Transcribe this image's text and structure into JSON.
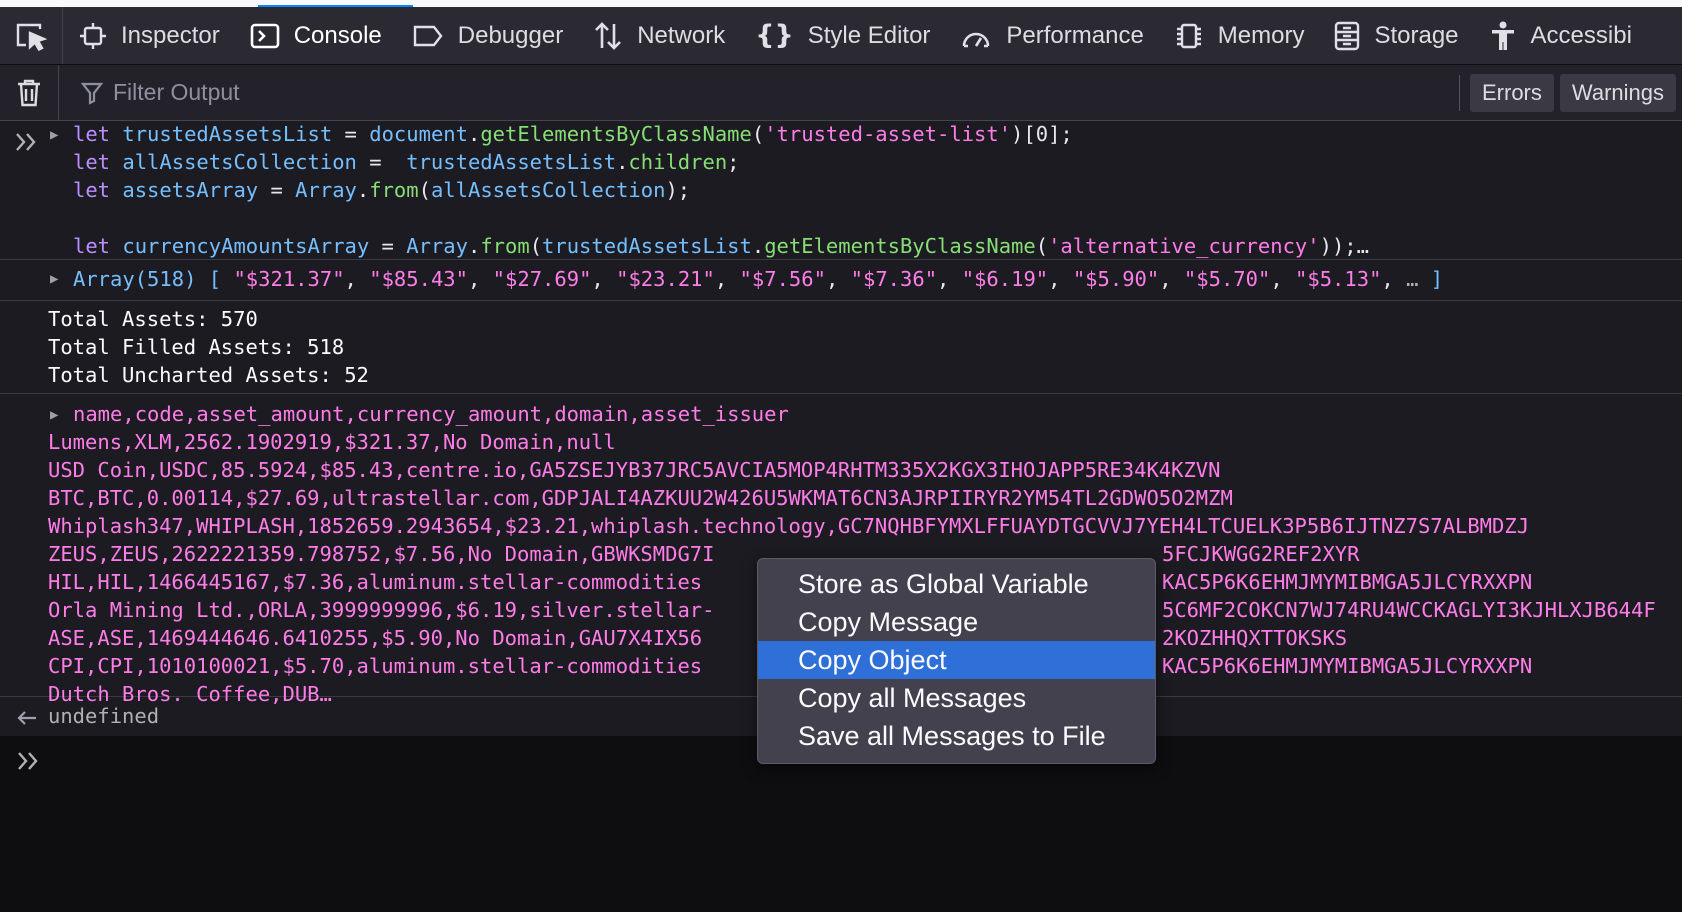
{
  "tabs": [
    {
      "label": "Inspector",
      "icon": "inspector-icon"
    },
    {
      "label": "Console",
      "icon": "console-icon",
      "selected": true
    },
    {
      "label": "Debugger",
      "icon": "debugger-icon"
    },
    {
      "label": "Network",
      "icon": "network-icon"
    },
    {
      "label": "Style Editor",
      "icon": "style-editor-icon"
    },
    {
      "label": "Performance",
      "icon": "performance-icon"
    },
    {
      "label": "Memory",
      "icon": "memory-icon"
    },
    {
      "label": "Storage",
      "icon": "storage-icon"
    },
    {
      "label": "Accessibi",
      "icon": "accessibility-icon"
    }
  ],
  "toolbar": {
    "filter_placeholder": "Filter Output",
    "errors_label": "Errors",
    "warnings_label": "Warnings"
  },
  "input_code": {
    "line1": {
      "kw": "let",
      "var": "trustedAssetsList",
      "op": " = ",
      "obj": "document",
      "fn": "getElementsByClassName",
      "str": "'trusted-asset-list'",
      "idx": ")[0];"
    },
    "line2": {
      "kw": "let",
      "var": "allAssetsCollection",
      "op": " =  ",
      "obj": "trustedAssetsList",
      "prop": "children",
      "end": ";"
    },
    "line3": {
      "kw": "let",
      "var": "assetsArray",
      "op": " = ",
      "obj": "Array",
      "fn": "from",
      "arg": "allAssetsCollection",
      "end": ");"
    },
    "line5": {
      "kw": "let",
      "var": "currencyAmountsArray",
      "op": " = ",
      "obj": "Array",
      "fn": "from",
      "arg_obj": "trustedAssetsList",
      "fn2": "getElementsByClassName",
      "str": "'alternative_currency'",
      "end": "));…"
    }
  },
  "array_output": {
    "label": "Array(518)",
    "items": [
      "\"$321.37\"",
      "\"$85.43\"",
      "\"$27.69\"",
      "\"$23.21\"",
      "\"$7.56\"",
      "\"$7.36\"",
      "\"$6.19\"",
      "\"$5.90\"",
      "\"$5.70\"",
      "\"$5.13\""
    ],
    "ellipsis": "…"
  },
  "totals": [
    "Total Assets: 570",
    "Total Filled Assets: 518",
    "Total Uncharted Assets: 52"
  ],
  "csv": {
    "header": "name,code,asset_amount,currency_amount,domain,asset_issuer",
    "rows": [
      {
        "left": "Lumens,XLM,2562.1902919,$321.37,No Domain,null",
        "right": ""
      },
      {
        "left": "USD Coin,USDC,85.5924,$85.43,centre.io,GA5ZSEJYB37JRC5AVCIA5MOP4RHTM335X2KGX3IHOJAPP5RE34K4KZVN",
        "right": ""
      },
      {
        "left": "BTC,BTC,0.00114,$27.69,ultrastellar.com,GDPJALI4AZKUU2W426U5WKMAT6CN3AJRPIIRYR2YM54TL2GDWO5O2MZM",
        "right": ""
      },
      {
        "left": "Whiplash347,WHIPLASH,1852659.2943654,$23.21,whiplash.technology,GC7NQHBFYMXLFFUAYDTGCVVJ7YEH4LTCUELK3P5B6IJTNZ7S7ALBMDZJ",
        "right": ""
      },
      {
        "left": "ZEUS,ZEUS,2622221359.798752,$7.56,No Domain,GBWKSMDG7I",
        "right": "5FCJKWGG2REF2XYR"
      },
      {
        "left": "HIL,HIL,1466445167,$7.36,aluminum.stellar-commodities",
        "right": "KAC5P6K6EHMJMYMIBMGA5JLCYRXXPN"
      },
      {
        "left": "Orla Mining Ltd.,ORLA,3999999996,$6.19,silver.stellar-",
        "right": "5C6MF2COKCN7WJ74RU4WCCKAGLYI3KJHLXJB644F"
      },
      {
        "left": "ASE,ASE,1469444646.6410255,$5.90,No Domain,GAU7X4IX56",
        "right": "2KOZHHQXTTOKSKS"
      },
      {
        "left": "CPI,CPI,1010100021,$5.70,aluminum.stellar-commodities",
        "right": "KAC5P6K6EHMJMYMIBMGA5JLCYRXXPN"
      },
      {
        "left": "Dutch Bros. Coffee,DUB…",
        "right": ""
      }
    ]
  },
  "return_value": "undefined",
  "context_menu": {
    "items": [
      {
        "label": "Store as Global Variable"
      },
      {
        "label": "Copy Message"
      },
      {
        "label": "Copy Object",
        "active": true
      },
      {
        "label": "Copy all Messages"
      },
      {
        "label": "Save all Messages to File"
      }
    ]
  }
}
